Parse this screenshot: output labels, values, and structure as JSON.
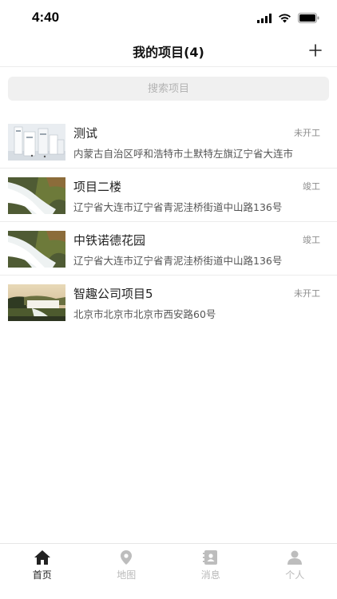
{
  "status_bar": {
    "time": "4:40"
  },
  "header": {
    "title": "我的项目(4)",
    "add_icon": "plus-icon"
  },
  "search": {
    "placeholder": "搜索项目",
    "value": ""
  },
  "projects": [
    {
      "name": "测试",
      "status": "未开工",
      "address": "内蒙古自治区呼和浩特市土默特左旗辽宁省大连市",
      "thumbnail": "buildings"
    },
    {
      "name": "项目二楼",
      "status": "竣工",
      "address": "辽宁省大连市辽宁省青泥洼桥街道中山路136号",
      "thumbnail": "waterfall"
    },
    {
      "name": "中铁诺德花园",
      "status": "竣工",
      "address": "辽宁省大连市辽宁省青泥洼桥街道中山路136号",
      "thumbnail": "waterfall"
    },
    {
      "name": "智趣公司项目5",
      "status": "未开工",
      "address": "北京市北京市北京市西安路60号",
      "thumbnail": "waterfall-landscape"
    }
  ],
  "tabs": [
    {
      "label": "首页",
      "icon": "home-icon",
      "active": true
    },
    {
      "label": "地图",
      "icon": "location-pin-icon",
      "active": false
    },
    {
      "label": "消息",
      "icon": "contacts-icon",
      "active": false
    },
    {
      "label": "个人",
      "icon": "person-icon",
      "active": false
    }
  ],
  "colors": {
    "active_tab": "#222222",
    "inactive_tab": "#b9b9b9",
    "search_bg": "#f0f0f0"
  }
}
